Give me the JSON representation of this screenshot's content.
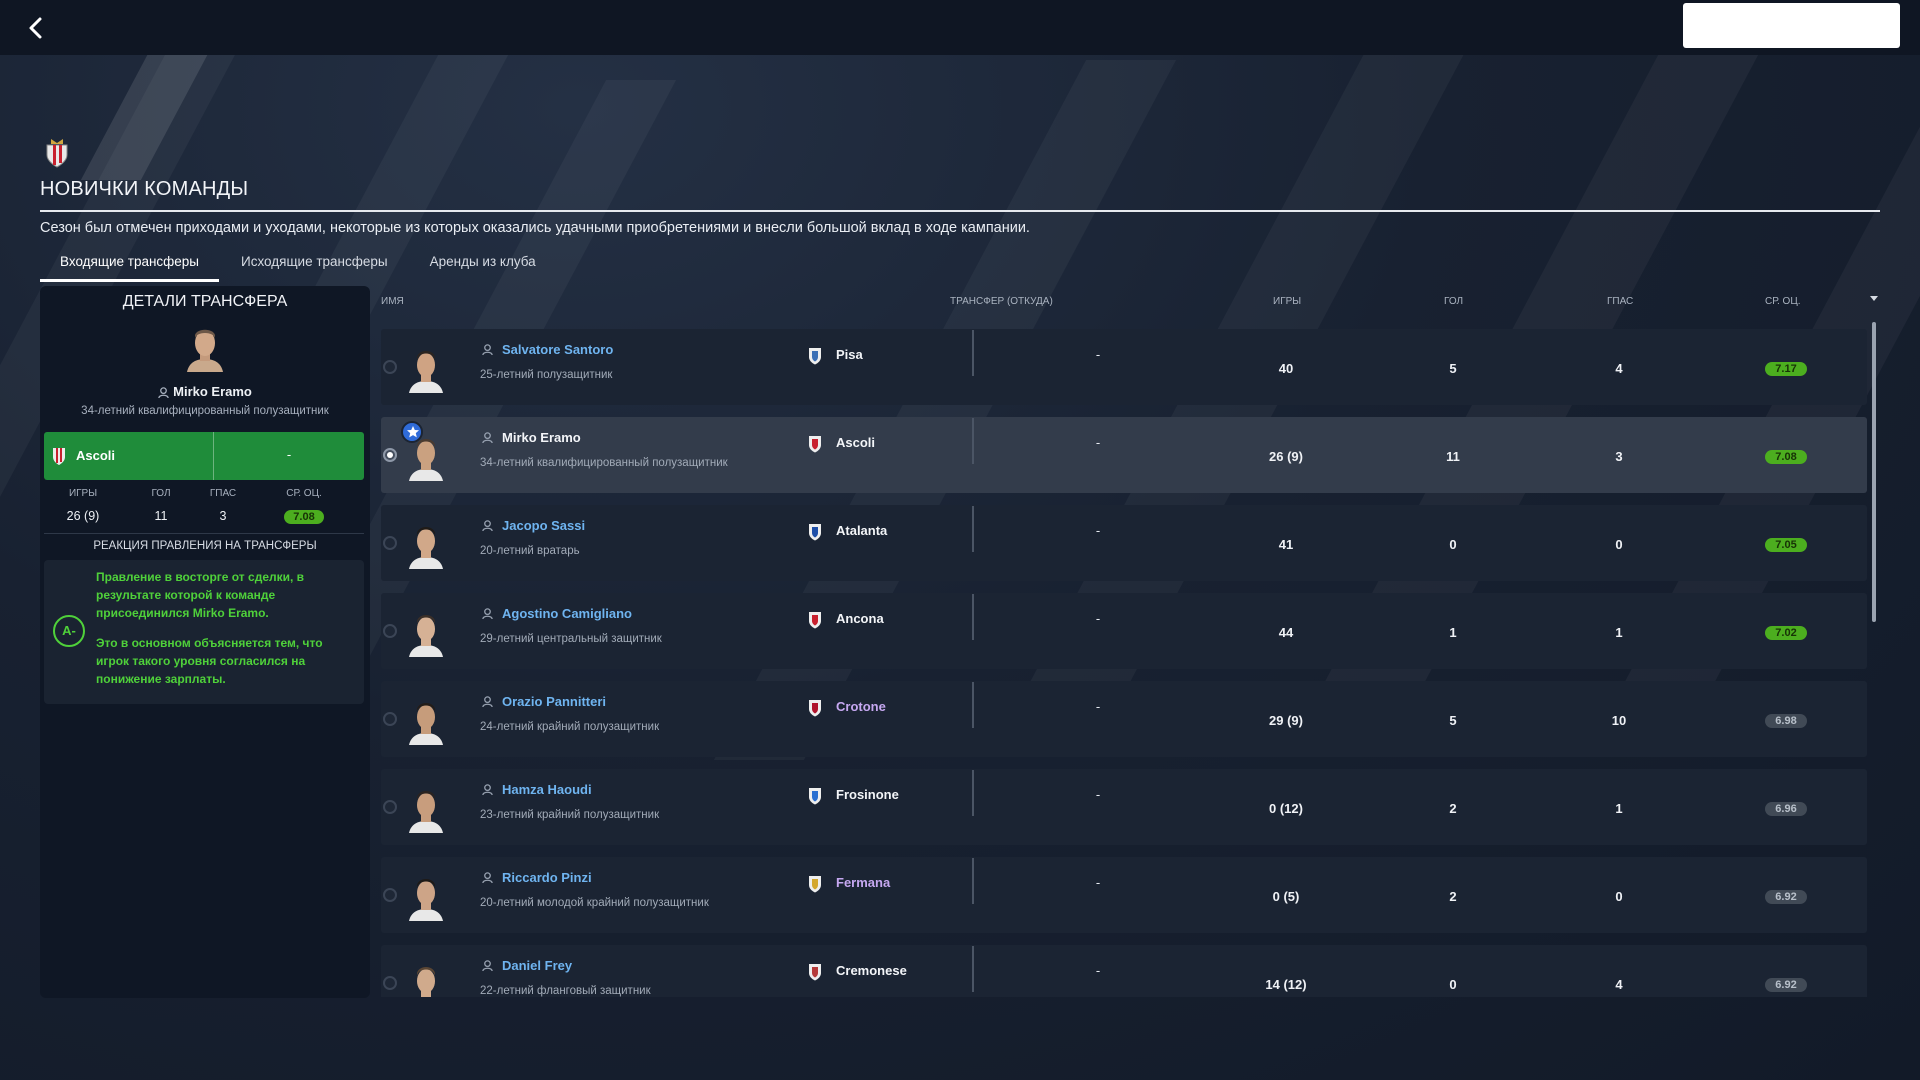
{
  "header": {
    "title": "НОВИЧКИ КОМАНДЫ",
    "subtitle": "Сезон был отмечен приходами и уходами, некоторые из которых оказались удачными приобретениями и внесли большой вклад в ходе кампании."
  },
  "tabs": [
    {
      "label": "Входящие трансферы",
      "active": true
    },
    {
      "label": "Исходящие трансферы",
      "active": false
    },
    {
      "label": "Аренды из клуба",
      "active": false
    }
  ],
  "details": {
    "title": "ДЕТАЛИ ТРАНСФЕРА",
    "name": "Mirko Eramo",
    "desc": "34-летний квалифицированный полузащитник",
    "from_club": "Ascoli",
    "fee": "-",
    "stat_labels": [
      "ИГРЫ",
      "ГОЛ",
      "ГПАС",
      "СР. ОЦ."
    ],
    "games": "26 (9)",
    "goals": "11",
    "assists": "3",
    "rating": "7.08",
    "reaction_title": "РЕАКЦИЯ ПРАВЛЕНИЯ НА ТРАНСФЕРЫ",
    "grade": "A-",
    "reaction_1": "Правление в восторге от сделки, в результате которой к команде присоединился Mirko Eramo.",
    "reaction_2": "Это в основном объясняется тем, что игрок такого уровня согласился на понижение зарплаты."
  },
  "table": {
    "columns": [
      "ИМЯ",
      "ТРАНСФЕР (ОТКУДА)",
      "ИГРЫ",
      "ГОЛ",
      "ГПАС",
      "СР. ОЦ."
    ],
    "rows": [
      {
        "name": "Salvatore Santoro",
        "desc": "25-летний полузащитник",
        "club": "Pisa",
        "club_color": "white",
        "fee": "-",
        "games": "40",
        "goals": "5",
        "assists": "4",
        "rating": "7.17",
        "rating_style": "green"
      },
      {
        "name": "Mirko Eramo",
        "desc": "34-летний квалифицированный полузащитник",
        "club": "Ascoli",
        "club_color": "white",
        "fee": "-",
        "games": "26 (9)",
        "goals": "11",
        "assists": "3",
        "rating": "7.08",
        "rating_style": "green",
        "selected": true,
        "star": true
      },
      {
        "name": "Jacopo Sassi",
        "desc": "20-летний вратарь",
        "club": "Atalanta",
        "club_color": "white",
        "fee": "-",
        "games": "41",
        "goals": "0",
        "assists": "0",
        "rating": "7.05",
        "rating_style": "green"
      },
      {
        "name": "Agostino Camigliano",
        "desc": "29-летний центральный защитник",
        "club": "Ancona",
        "club_color": "white",
        "fee": "-",
        "games": "44",
        "goals": "1",
        "assists": "1",
        "rating": "7.02",
        "rating_style": "green"
      },
      {
        "name": "Orazio Pannitteri",
        "desc": "24-летний крайний полузащитник",
        "club": "Crotone",
        "club_color": "purple",
        "fee": "-",
        "games": "29 (9)",
        "goals": "5",
        "assists": "10",
        "rating": "6.98",
        "rating_style": "gray"
      },
      {
        "name": "Hamza Haoudi",
        "desc": "23-летний крайний полузащитник",
        "club": "Frosinone",
        "club_color": "white",
        "fee": "-",
        "games": "0 (12)",
        "goals": "2",
        "assists": "1",
        "rating": "6.96",
        "rating_style": "gray"
      },
      {
        "name": "Riccardo Pinzi",
        "desc": "20-летний молодой крайний полузащитник",
        "club": "Fermana",
        "club_color": "purple",
        "fee": "-",
        "games": "0 (5)",
        "goals": "2",
        "assists": "0",
        "rating": "6.92",
        "rating_style": "gray"
      },
      {
        "name": "Daniel Frey",
        "desc": "22-летний фланговый защитник",
        "club": "Cremonese",
        "club_color": "white",
        "fee": "-",
        "games": "14 (12)",
        "goals": "0",
        "assists": "4",
        "rating": "6.92",
        "rating_style": "gray"
      }
    ]
  },
  "colors": {
    "accent_green": "#4cae1f",
    "link_blue": "#6fb4f0",
    "club_purple": "#c6a8f1",
    "from_bar": "#1f8c3a"
  }
}
